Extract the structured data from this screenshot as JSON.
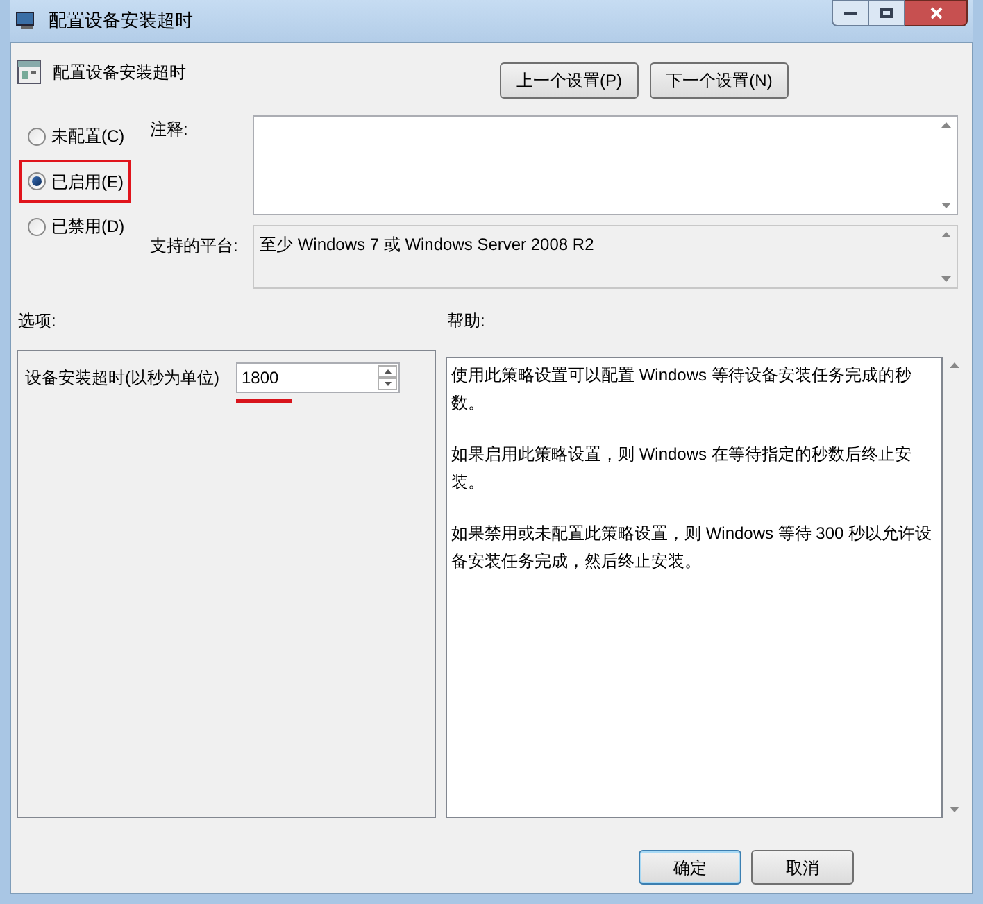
{
  "window": {
    "title": "配置设备安装超时"
  },
  "header": {
    "title": "配置设备安装超时"
  },
  "nav_buttons": [
    "上一个设置(P)",
    "下一个设置(N)"
  ],
  "radios": [
    {
      "label": "未配置(C)",
      "selected": false,
      "highlighted": false
    },
    {
      "label": "已启用(E)",
      "selected": true,
      "highlighted": true
    },
    {
      "label": "已禁用(D)",
      "selected": false,
      "highlighted": false
    }
  ],
  "comment": {
    "label": "注释:"
  },
  "platform": {
    "label": "支持的平台:",
    "value": "至少 Windows 7 或 Windows Server 2008 R2"
  },
  "options": {
    "label": "选项:",
    "field_label": "设备安装超时(以秒为单位)",
    "value": "1800",
    "underlined": true
  },
  "help": {
    "label": "帮助:",
    "paragraphs": [
      "使用此策略设置可以配置 Windows 等待设备安装任务完成的秒数。",
      "如果启用此策略设置，则 Windows 在等待指定的秒数后终止安装。",
      "如果禁用或未配置此策略设置，则 Windows 等待 300 秒以允许设备安装任务完成，然后终止安装。"
    ]
  },
  "buttons": [
    "确定",
    "取消"
  ]
}
